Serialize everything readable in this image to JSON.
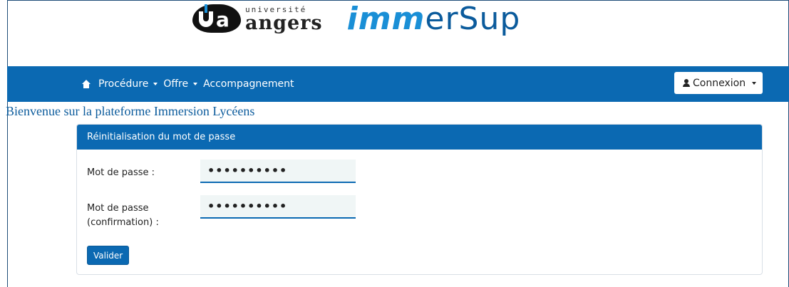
{
  "header": {
    "university_small": "université",
    "university_big": "angers",
    "app_logo_prefix": "imm",
    "app_logo_suffix": "erSup"
  },
  "navbar": {
    "home_icon": "home-icon",
    "items": [
      {
        "label": "Procédure",
        "dropdown": true
      },
      {
        "label": "Offre",
        "dropdown": true
      },
      {
        "label": "Accompagnement",
        "dropdown": false
      }
    ],
    "connexion_label": "Connexion",
    "connexion_icon": "user-icon"
  },
  "welcome_text": "Bienvenue sur la plateforme Immersion Lycéens",
  "card": {
    "title": "Réinitialisation du mot de passe",
    "password_label": "Mot de passe :",
    "password_value": "••••••••••",
    "confirm_label_line1": "Mot de passe",
    "confirm_label_line2": "(confirmation) :",
    "confirm_value": "••••••••••",
    "submit_label": "Valider"
  },
  "colors": {
    "primary": "#0b69b2",
    "brand_light": "#1a8fd6",
    "brand_dark": "#0b5b9c"
  }
}
